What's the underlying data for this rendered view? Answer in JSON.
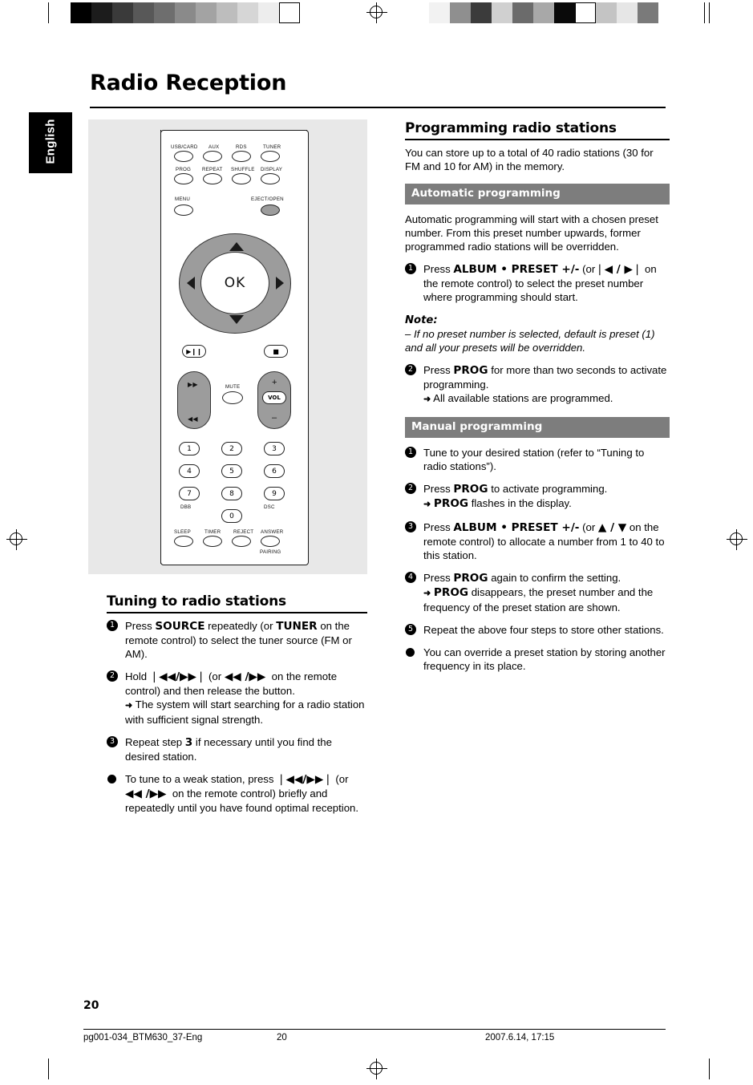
{
  "document": {
    "title": "Radio Reception",
    "language_tab": "English",
    "page_number": "20",
    "footer": {
      "file": "pg001-034_BTM630_37-Eng",
      "page": "20",
      "timestamp": "2007.6.14, 17:15"
    }
  },
  "remote": {
    "rows": [
      [
        "USB/CARD",
        "AUX",
        "RDS",
        "TUNER"
      ],
      [
        "PROG",
        "REPEAT",
        "SHUFFLE",
        "DISPLAY"
      ]
    ],
    "menu_label": "MENU",
    "eject_label": "EJECT/OPEN",
    "ok_label": "OK",
    "mute_label": "MUTE",
    "vol_label": "VOL",
    "vol_plus": "+",
    "vol_minus": "–",
    "numbers": [
      "1",
      "2",
      "3",
      "4",
      "5",
      "6",
      "7",
      "8",
      "9",
      "0"
    ],
    "dbb_label": "DBB",
    "dsc_label": "DSC",
    "bottom_labels": [
      "SLEEP",
      "TIMER",
      "REJECT",
      "ANSWER"
    ],
    "pairing_label": "PAIRING"
  },
  "left_column": {
    "heading": "Tuning to radio stations",
    "steps": [
      {
        "marker": "1",
        "type": "num",
        "html": "Press <b class=\"bold\">SOURCE</b> repeatedly (or <b class=\"bold\">TUNER</b> on the remote control) to select the tuner source (FM or AM)."
      },
      {
        "marker": "2",
        "type": "num",
        "html": "Hold <b class=\"bold nowrapsym\">❘◀◀/▶▶❘</b> (or <b class=\"bold nowrapsym\">◀◀ /▶▶</b> &nbsp;on the remote control) and then release the button.<br><span class=\"arrow\">➜</span> The system will start searching for a radio station with sufficient signal strength."
      },
      {
        "marker": "3",
        "type": "num",
        "html": "Repeat step <b class=\"bold\">3</b> if necessary until you find the desired station."
      },
      {
        "marker": "●",
        "type": "dot",
        "html": "To tune to a weak station, press <b class=\"bold nowrapsym\">❘◀◀/▶▶❘</b> (or <b class=\"bold nowrapsym\">◀◀ /▶▶</b> &nbsp;on the remote control) briefly and repeatedly until you have found optimal reception."
      }
    ]
  },
  "right_column": {
    "heading": "Programming radio stations",
    "intro": "You can store up to a total of 40 radio stations (30 for FM and 10 for AM) in the memory.",
    "auto": {
      "bar": "Automatic programming",
      "intro": "Automatic programming will start with a chosen preset number. From this preset number upwards, former programmed radio stations will be overridden.",
      "steps": [
        {
          "marker": "1",
          "type": "num",
          "html": "Press <b class=\"bold\">ALBUM • PRESET +/-</b> (or<b class=\"bold nowrapsym\">❘◀ / ▶❘</b> on the remote control) to select the preset number where programming should start."
        },
        {
          "marker": "2",
          "type": "num",
          "html": "Press <b class=\"bold\">PROG</b> for more than two seconds to activate programming.<br><span class=\"arrow\">➜</span> All available stations are programmed."
        }
      ],
      "note_label": "Note:",
      "note_text": "–  If no preset number is selected, default is preset (1) and all your presets will be overridden."
    },
    "manual": {
      "bar": "Manual programming",
      "steps": [
        {
          "marker": "1",
          "type": "num",
          "html": "Tune to your desired station (refer to “Tuning to radio stations”)."
        },
        {
          "marker": "2",
          "type": "num",
          "html": "Press <b class=\"bold\">PROG</b> to activate programming.<br><span class=\"arrow\">➜</span> <b class=\"bold\">PROG</b> flashes in the display."
        },
        {
          "marker": "3",
          "type": "num",
          "html": "Press <b class=\"bold\">ALBUM • PRESET +/-</b> (or <b class=\"bold nowrapsym\">▲ / ▼</b> on the remote control) to allocate a number from 1 to 40 to this station."
        },
        {
          "marker": "4",
          "type": "num",
          "html": "Press <b class=\"bold\">PROG</b> again to confirm the setting.<br><span class=\"arrow\">➜</span> <b class=\"bold\">PROG</b> disappears, the preset number and the frequency of the preset station are shown."
        },
        {
          "marker": "5",
          "type": "num",
          "html": "Repeat the above four steps to store other stations."
        },
        {
          "marker": "●",
          "type": "dot",
          "html": "You can override a preset station by storing another frequency in its place."
        }
      ]
    }
  },
  "colors": {
    "grey_bar": "#7d7d7d",
    "image_bg": "#e8e8e8",
    "tab_bg": "#000000"
  }
}
